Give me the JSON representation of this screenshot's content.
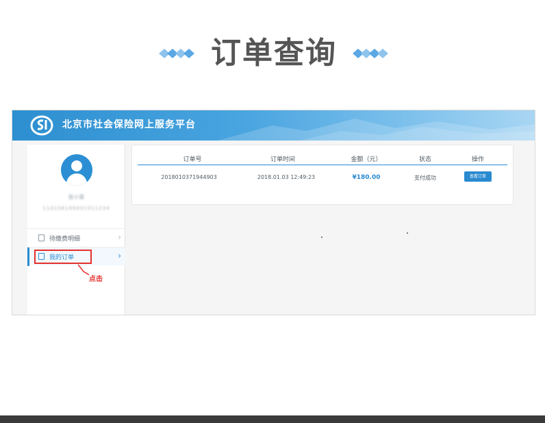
{
  "page": {
    "title": "订单查询"
  },
  "app": {
    "site_name": "北京市社会保险网上服务平台",
    "logo": "si-logo-icon",
    "colors": {
      "header": "#2d8fd0",
      "accent": "#2a8ad0",
      "highlight": "#e3302d"
    }
  },
  "sidebar": {
    "user_name": "张小星",
    "user_id": "110108199001011234",
    "items": [
      {
        "label": "待缴费明细",
        "icon": "document-icon",
        "active": false
      },
      {
        "label": "我的订单",
        "icon": "order-icon",
        "active": true
      }
    ],
    "callout_label": "点击"
  },
  "orders": {
    "columns": [
      "订单号",
      "订单时间",
      "金额（元）",
      "状态",
      "操作"
    ],
    "rows": [
      {
        "order_no": "2018010371944903",
        "time": "2018.01.03 12:49:23",
        "amount": "¥180.00",
        "status": "支付成功",
        "action": "查看订单"
      }
    ]
  }
}
